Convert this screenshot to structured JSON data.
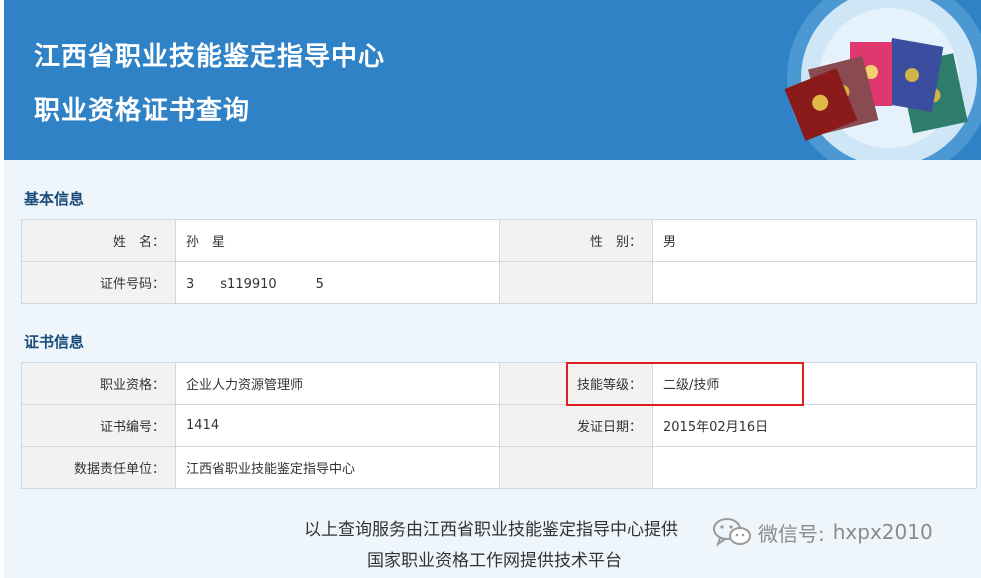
{
  "header": {
    "line1": "江西省职业技能鉴定指导中心",
    "line2": "职业资格证书查询"
  },
  "basic_info": {
    "title": "基本信息",
    "name_label": "姓　名：",
    "name_value": "孙　星",
    "gender_label": "性　别：",
    "gender_value": "男",
    "id_label": "证件号码：",
    "id_value": "3　　s119910　　　5"
  },
  "cert_info": {
    "title": "证书信息",
    "qualification_label": "职业资格：",
    "qualification_value": "企业人力资源管理师",
    "level_label": "技能等级：",
    "level_value": "二级/技师",
    "cert_no_label": "证书编号：",
    "cert_no_value": "1414",
    "issue_date_label": "发证日期：",
    "issue_date_value": "2015年02月16日",
    "unit_label": "数据责任单位：",
    "unit_value": "江西省职业技能鉴定指导中心"
  },
  "footer": {
    "line1": "以上查询服务由江西省职业技能鉴定指导中心提供",
    "line2": "国家职业资格工作网提供技术平台"
  },
  "watermark": {
    "label": "微信号:",
    "id": "hxpx2010",
    "icon": "wechat-icon"
  },
  "colors": {
    "banner": "#2f82c6",
    "content_bg": "#eef6fb",
    "section_title": "#1a4a7a",
    "highlight_border": "#e02020"
  }
}
